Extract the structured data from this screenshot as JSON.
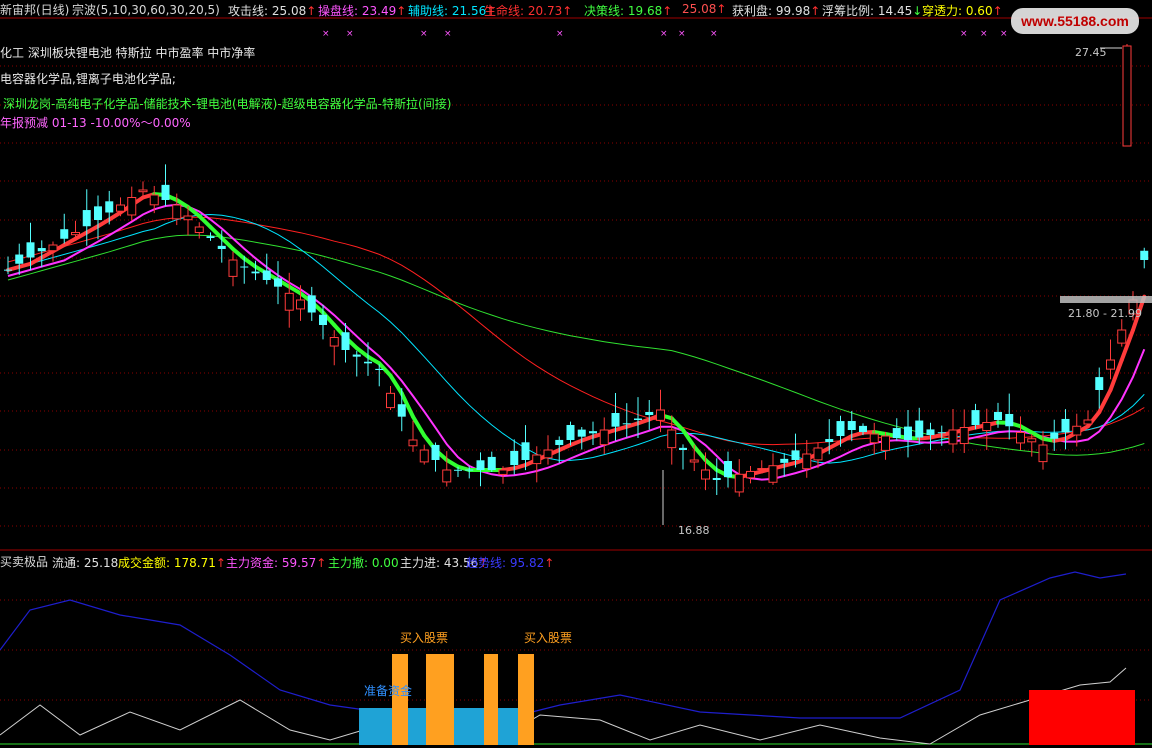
{
  "header": {
    "stock_name": "新宙邦(日线)",
    "ma_label": "宗波(5,10,30,60,30,20,5)",
    "indicators": [
      {
        "label": "攻击线",
        "value": "25.08",
        "dir": "↑",
        "color": "#e0e0e0"
      },
      {
        "label": "操盘线",
        "value": "23.49",
        "dir": "↑",
        "color": "#ff55ff"
      },
      {
        "label": "辅助线",
        "value": "21.56",
        "dir": "↑",
        "color": "#00e5ff"
      },
      {
        "label": "生命线",
        "value": "20.73",
        "dir": "↑",
        "color": "#ff3030"
      },
      {
        "label": "决策线",
        "value": "19.68",
        "dir": "↑",
        "color": "#40ff40"
      },
      {
        "label": "",
        "value": "25.08",
        "dir": "↑",
        "color": "#ff5050"
      },
      {
        "label": "获利盘",
        "value": "99.98",
        "dir": "↑",
        "color": "#e0e0e0"
      },
      {
        "label": "浮筹比例",
        "value": "14.45",
        "dir": "↓",
        "color": "#e0e0e0"
      },
      {
        "label": "穿透力",
        "value": "0.60",
        "dir": "↑",
        "color": "#ffff00"
      }
    ],
    "watermark": "www.55188.com"
  },
  "overlay": {
    "line1": "化工 深圳板块锂电池 特斯拉 中市盈率 中市净率",
    "line2": "电容器化学品,锂离子电池化学品;",
    "line3": "深圳龙岗-高纯电子化学品-储能技术-锂电池(电解液)-超级电容器化学品-特斯拉(间接)",
    "line4": "年报预减 01-13 -10.00%～0.00%"
  },
  "labels": {
    "high_price": "27.45",
    "low_price": "16.88",
    "current_range": "21.80 - 21.99"
  },
  "sub_header": {
    "name": "买卖极品",
    "items": [
      {
        "label": "流通",
        "value": "25.18",
        "dir": "",
        "color": "#e0e0e0"
      },
      {
        "label": "成交金额",
        "value": "178.71",
        "dir": "↑",
        "color": "#ffff00"
      },
      {
        "label": "主力资金",
        "value": "59.57",
        "dir": "↑",
        "color": "#ff55ff"
      },
      {
        "label": "主力撤",
        "value": "0.00",
        "dir": "",
        "color": "#40ff40"
      },
      {
        "label": "主力进",
        "value": "43.56",
        "dir": "↑",
        "color": "#e0e0e0"
      },
      {
        "label": "趋势线",
        "value": "95.82",
        "dir": "↑",
        "color": "#3a3aff"
      }
    ]
  },
  "signals": {
    "buy_label_1": "买入股票",
    "buy_label_2": "买入股票",
    "prepare_label": "准备资金"
  },
  "colors": {
    "up": "#ff3b3b",
    "down": "#54ffff",
    "ma5": "#ffffff",
    "ma10": "#ff33ff",
    "ma30": "#00e5ff",
    "ma60": "#ff2020",
    "ma120": "#30e030",
    "grid": "#8b0000"
  }
}
